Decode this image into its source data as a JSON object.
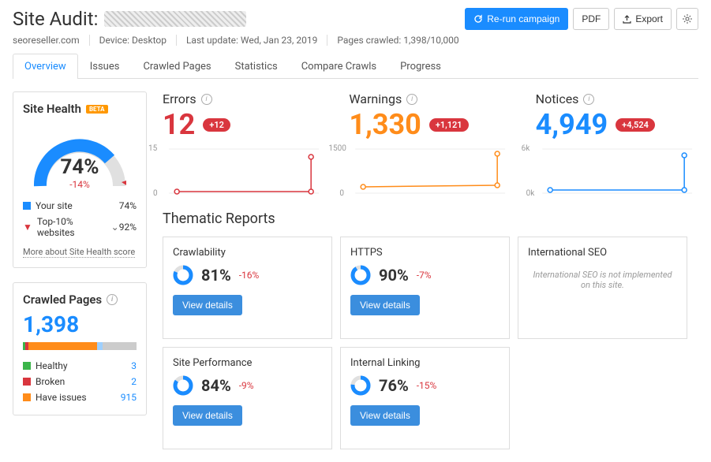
{
  "header": {
    "title": "Site Audit:",
    "rerun": "Re-run campaign",
    "pdf": "PDF",
    "export": "Export"
  },
  "meta": {
    "domain": "seoreseller.com",
    "device": "Device: Desktop",
    "last_update": "Last update: Wed, Jan 23, 2019",
    "pages_crawled": "Pages crawled: 1,398/10,000"
  },
  "tabs": [
    "Overview",
    "Issues",
    "Crawled Pages",
    "Statistics",
    "Compare Crawls",
    "Progress"
  ],
  "site_health": {
    "title": "Site Health",
    "beta": "BETA",
    "pct": "74%",
    "delta": "-14%",
    "your_site": "Your site",
    "your_val": "74%",
    "top10": "Top-10% websites",
    "top10_val": "92%",
    "more": "More about Site Health score"
  },
  "crawled": {
    "title": "Crawled Pages",
    "count": "1,398",
    "healthy": "Healthy",
    "healthy_n": "3",
    "broken": "Broken",
    "broken_n": "2",
    "issues": "Have issues",
    "issues_n": "915"
  },
  "metrics": {
    "errors": {
      "label": "Errors",
      "value": "12",
      "pill": "+12",
      "ymax": "15",
      "ymin": "0"
    },
    "warnings": {
      "label": "Warnings",
      "value": "1,330",
      "pill": "+1,121",
      "ymax": "1500",
      "ymin": "0"
    },
    "notices": {
      "label": "Notices",
      "value": "4,949",
      "pill": "+4,524",
      "ymax": "6k",
      "ymin": "0k"
    }
  },
  "thematic": {
    "title": "Thematic Reports",
    "view": "View details",
    "crawlability": {
      "title": "Crawlability",
      "pct": "81%",
      "delta": "-16%"
    },
    "https": {
      "title": "HTTPS",
      "pct": "90%",
      "delta": "-7%"
    },
    "intl": {
      "title": "International SEO",
      "msg": "International SEO is not implemented on this site."
    },
    "perf": {
      "title": "Site Performance",
      "pct": "84%",
      "delta": "-9%"
    },
    "linking": {
      "title": "Internal Linking",
      "pct": "76%",
      "delta": "-15%"
    }
  },
  "chart_data": [
    {
      "type": "line",
      "title": "Errors",
      "x": [
        0,
        1
      ],
      "values": [
        0,
        12
      ],
      "ylim": [
        0,
        15
      ]
    },
    {
      "type": "line",
      "title": "Warnings",
      "x": [
        0,
        1
      ],
      "values": [
        209,
        1330
      ],
      "ylim": [
        0,
        1500
      ]
    },
    {
      "type": "line",
      "title": "Notices",
      "x": [
        0,
        1
      ],
      "values": [
        425,
        4949
      ],
      "ylim": [
        0,
        6000
      ]
    }
  ]
}
